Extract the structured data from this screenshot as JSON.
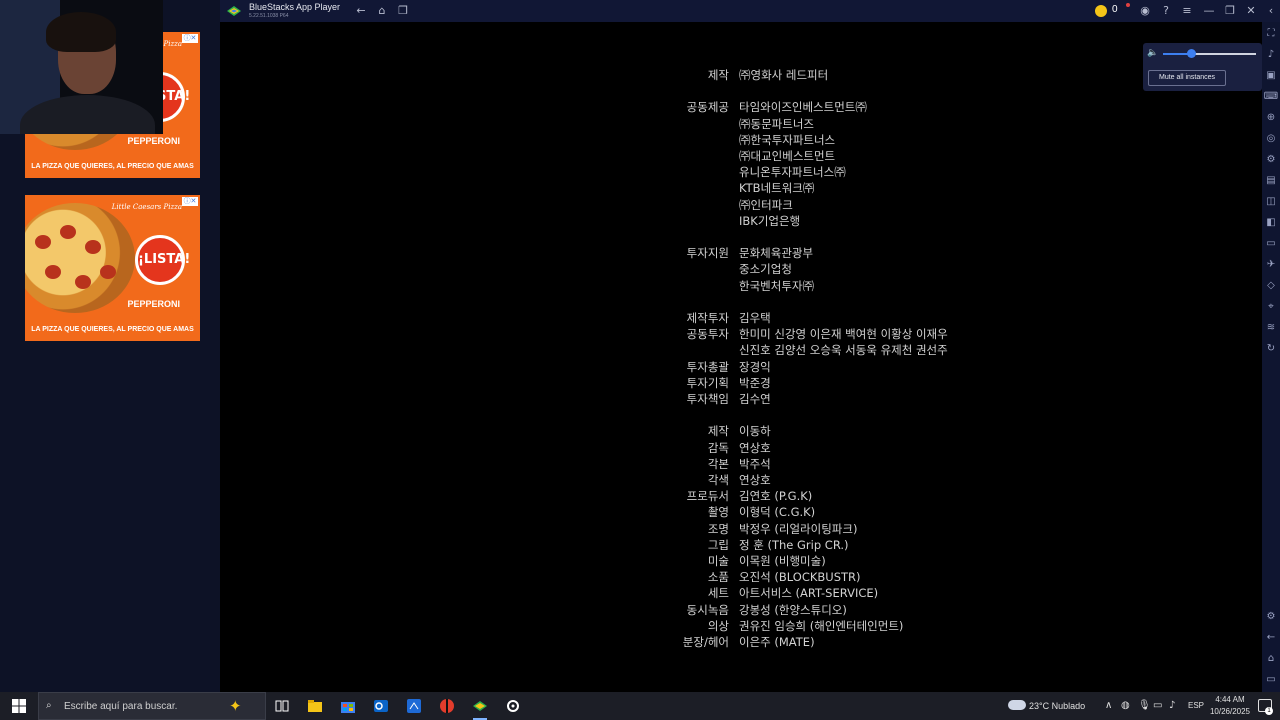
{
  "window": {
    "title": "BlueStacks App Player",
    "version": "5.22.51.1038  P64",
    "coins": "0"
  },
  "ads": [
    {
      "brand": "Little Caesars Pizza",
      "badge": "¡LISTA!",
      "product": "PEPPERONI",
      "promo": "LA PIZZA QUE QUIERES, AL PRECIO QUE AMAS"
    },
    {
      "brand": "Little Caesars Pizza",
      "badge": "¡LISTA!",
      "product": "PEPPERONI",
      "promo": "LA PIZZA QUE QUIERES, AL PRECIO QUE AMAS"
    }
  ],
  "volume": {
    "level": 0.3,
    "mute_all_label": "Mute all instances"
  },
  "credits": [
    {
      "role": "제작",
      "names": [
        "㈜영화사 레드피터"
      ]
    },
    {
      "role": "공동제공",
      "names": [
        "타임와이즈인베스트먼트㈜",
        "㈜동문파트너즈",
        "㈜한국투자파트너스",
        "㈜대교인베스트먼트",
        "유니온투자파트너스㈜",
        "KTB네트워크㈜",
        "㈜인터파크",
        "IBK기업은행"
      ]
    },
    {
      "role": "투자지원",
      "names": [
        "문화체육관광부",
        "중소기업청",
        "한국벤처투자㈜"
      ]
    },
    {
      "role": "제작투자",
      "names": [
        "김우택"
      ]
    },
    {
      "role": "공동투자",
      "names": [
        "한미미 신강영 이은재 백여현 이황상 이재우",
        "신진호 김양선 오승욱 서동욱 유제천 권선주"
      ]
    },
    {
      "role": "투자총괄",
      "names": [
        "장경익"
      ]
    },
    {
      "role": "투자기획",
      "names": [
        "박준경"
      ]
    },
    {
      "role": "투자책임",
      "names": [
        "김수연"
      ]
    },
    {
      "role": "제작",
      "names": [
        "이동하"
      ]
    },
    {
      "role": "감독",
      "names": [
        "연상호"
      ]
    },
    {
      "role": "각본",
      "names": [
        "박주석"
      ]
    },
    {
      "role": "각색",
      "names": [
        "연상호"
      ]
    },
    {
      "role": "프로듀서",
      "names": [
        "김연호 (P.G.K)"
      ]
    },
    {
      "role": "촬영",
      "names": [
        "이형덕 (C.G.K)"
      ]
    },
    {
      "role": "조명",
      "names": [
        "박정우 (리얼라이팅파크)"
      ]
    },
    {
      "role": "그립",
      "names": [
        "정   훈 (The Grip CR.)"
      ]
    },
    {
      "role": "미술",
      "names": [
        "이목원 (비행미술)"
      ]
    },
    {
      "role": "소품",
      "names": [
        "오진석 (BLOCKBUSTR)"
      ]
    },
    {
      "role": "세트",
      "names": [
        "아트서비스 (ART-SERVICE)"
      ]
    },
    {
      "role": "동시녹음",
      "names": [
        "강봉성 (한양스튜디오)"
      ]
    },
    {
      "role": "의상",
      "names": [
        "권유진 임승희 (해인엔터테인먼트)"
      ]
    },
    {
      "role": "분장/헤어",
      "names": [
        "이은주 (MATE)"
      ]
    }
  ],
  "taskbar": {
    "search_placeholder": "Escribe aquí para buscar.",
    "weather": "23°C  Nublado",
    "language": "ESP",
    "time": "4:44 AM",
    "date": "10/26/2025",
    "notifications": "1"
  },
  "colors": {
    "titlebar": "#111735",
    "accent": "#3d7ff0",
    "ad_orange": "#f26a1b"
  }
}
